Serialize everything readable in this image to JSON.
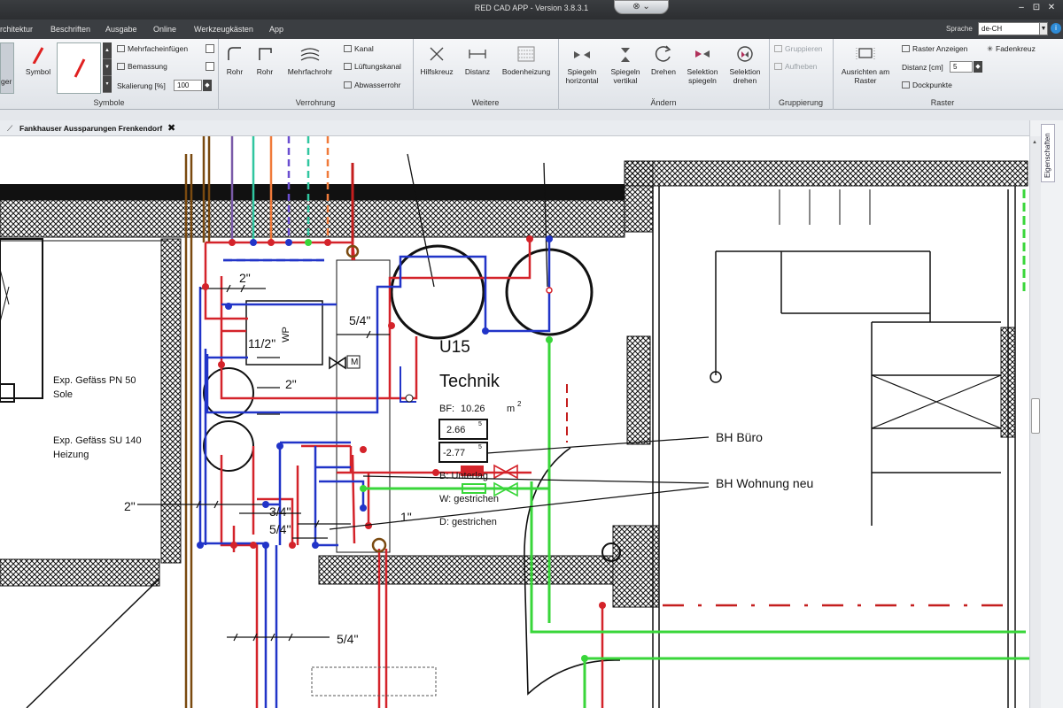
{
  "app": {
    "title": "RED CAD APP - Version 3.8.3.1",
    "quick_icons": "⊗ ⌄",
    "window_controls": [
      "–",
      "⊡",
      "✕"
    ]
  },
  "menu": {
    "items": [
      "rchitektur",
      "Beschriften",
      "Ausgabe",
      "Online",
      "Werkzeugkästen",
      "App"
    ],
    "language_label": "Sprache",
    "language_value": "de-CH"
  },
  "ribbon": {
    "groups": {
      "symbole": "Symbole",
      "verrohrung": "Verrohrung",
      "weitere": "Weitere",
      "aendern": "Ändern",
      "gruppierung": "Gruppierung",
      "raster": "Raster"
    },
    "symbole": {
      "partial_left": "ger",
      "symbol_label": "Symbol",
      "mehrfach": "Mehrfacheinfügen",
      "bemassung": "Bemassung",
      "skalierung": "Skalierung [%]",
      "skalierung_value": "100"
    },
    "verrohrung": {
      "rohr1": "Rohr",
      "rohr2": "Rohr",
      "mehrfachrohr": "Mehrfachrohr",
      "kanal": "Kanal",
      "lueftungskanal": "Lüftungskanal",
      "abwasserrohr": "Abwasserrohr"
    },
    "weitere": {
      "hilfskreuz": "Hilfskreuz",
      "distanz": "Distanz",
      "bodenheizung": "Bodenheizung"
    },
    "aendern": {
      "spiegeln_h": [
        "Spiegeln",
        "horizontal"
      ],
      "spiegeln_v": [
        "Spiegeln",
        "vertikal"
      ],
      "drehen": "Drehen",
      "sel_spiegeln": [
        "Selektion",
        "spiegeln"
      ],
      "sel_drehen": [
        "Selektion",
        "drehen"
      ]
    },
    "gruppierung": {
      "gruppieren": "Gruppieren",
      "aufheben": "Aufheben"
    },
    "raster": {
      "ausrichten": [
        "Ausrichten am",
        "Raster"
      ],
      "anzeigen": "Raster Anzeigen",
      "distanz": "Distanz [cm]",
      "distanz_value": "5",
      "dockpunkte": "Dockpunkte",
      "fadenkreuz": "Fadenkreuz"
    }
  },
  "document": {
    "tab_title": "Fankhauser Aussparungen Frenkendorf"
  },
  "side_panel": {
    "tab": "Eigenschaften"
  },
  "plan": {
    "labels": {
      "size_2_top": "2\"",
      "size_11_2": "11/2\"",
      "size_5_4_top": "5/4\"",
      "size_2_mid": "2\"",
      "size_2_left": "2\"",
      "size_3_4": "3/4\"",
      "size_5_4_mid": "5/4\"",
      "size_1": "1\"",
      "size_5_4_bottom": "5/4\"",
      "wp": "WP",
      "motor": "M",
      "exp1_line1": "Exp. Gefäss PN 50",
      "exp1_line2": "Sole",
      "exp2_line1": "Exp. Gefäss SU 140",
      "exp2_line2": "Heizung",
      "room_no": "U15",
      "room_name": "Technik",
      "bf_label": "BF:",
      "bf_value": "10.26",
      "bf_unit": "m",
      "bf_exp": "2",
      "level_1": "2.66",
      "level_2": "-2.77",
      "level_sup": "5",
      "finish_b": "B:  Unterlag",
      "finish_w": "W:  gestrichen",
      "finish_d": "D:  gestrichen",
      "bh_buero": "BH Büro",
      "bh_wohnung": "BH Wohnung neu"
    }
  }
}
